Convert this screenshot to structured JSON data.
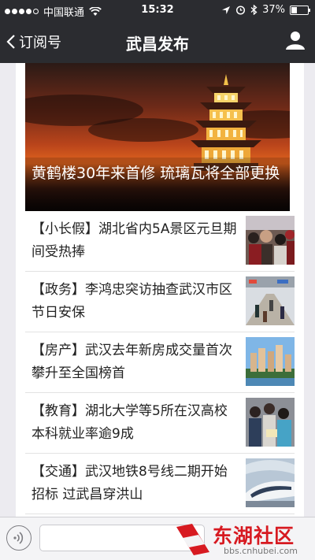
{
  "status_bar": {
    "carrier": "中国联通",
    "time": "15:32",
    "battery": "37%",
    "battery_level": 0.37
  },
  "nav": {
    "back_label": "订阅号",
    "title": "武昌发布"
  },
  "hero": {
    "title": "黄鹤楼30年来首修 琉璃瓦将全部更换"
  },
  "news": [
    {
      "title": "【小长假】湖北省内5A景区元旦期间受热捧",
      "thumb_icon": "crowd-photo"
    },
    {
      "title": "【政务】李鸿忠突访抽查武汉市区节日安保",
      "thumb_icon": "station-photo"
    },
    {
      "title": "【房产】武汉去年新房成交量首次攀升至全国榜首",
      "thumb_icon": "buildings-photo"
    },
    {
      "title": "【教育】湖北大学等5所在汉高校本科就业率逾9成",
      "thumb_icon": "students-photo"
    },
    {
      "title": "【交通】武汉地铁8号线二期开始招标 过武昌穿洪山",
      "thumb_icon": "train-photo"
    }
  ],
  "input_bar": {
    "placeholder": ""
  },
  "watermark": {
    "text": "东湖社区",
    "url": "bbs.cnhubei.com"
  }
}
